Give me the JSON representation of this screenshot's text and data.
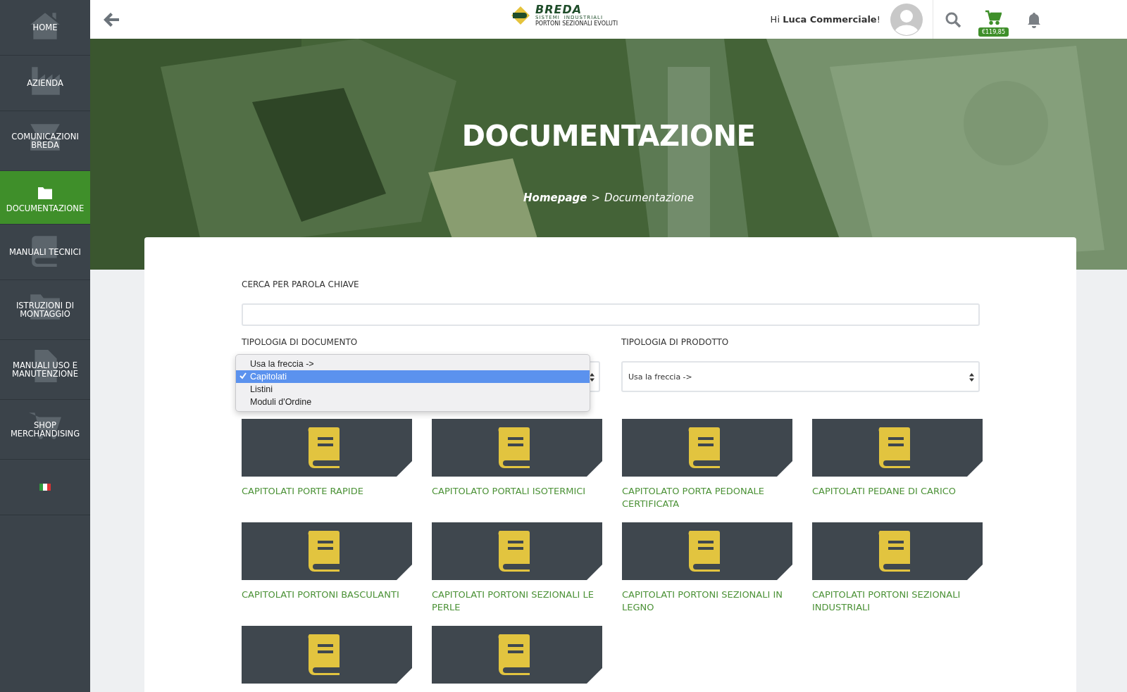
{
  "sidebar": {
    "items": [
      {
        "label": "HOME",
        "selected": false
      },
      {
        "label": "AZIENDA",
        "selected": false
      },
      {
        "label": "COMUNICAZIONI BREDA",
        "selected": false
      },
      {
        "label": "DOCUMENTAZIONE",
        "selected": true
      },
      {
        "label": "MANUALI TECNICI",
        "selected": false
      },
      {
        "label": "ISTRUZIONI DI MONTAGGIO",
        "selected": false
      },
      {
        "label": "MANUALI USO E MANUTENZIONE",
        "selected": false
      },
      {
        "label": "SHOP MERCHANDISING",
        "selected": false
      },
      {
        "selected": false
      }
    ]
  },
  "header": {
    "logo": {
      "name": "BREDA",
      "left": "SISTEMI",
      "right": "INDUSTRIALI",
      "tagline": "PORTONI SEZIONALI EVOLUTI"
    },
    "greeting": "Hi",
    "user": "Luca Commerciale",
    "punct": "!",
    "cart_total": "€119,85"
  },
  "hero": {
    "kind": "picture",
    "title": "DOCUMENTAZIONE",
    "breadcrumb": [
      {
        "label": "Homepage"
      },
      {
        "label": "Documentazione"
      }
    ],
    "separator": ">"
  },
  "search": {
    "label": "CERCA PER PAROLA CHIAVE"
  },
  "filters": [
    {
      "label": "TIPOLOGIA DI DOCUMENTO",
      "expanded": true,
      "options": [
        {
          "label": "Usa la freccia ->",
          "selected": false
        },
        {
          "label": "Capitolati",
          "selected": true
        },
        {
          "label": "Listini",
          "selected": false
        },
        {
          "label": "Moduli d'Ordine",
          "selected": false
        }
      ]
    },
    {
      "label": "TIPOLOGIA DI PRODOTTO",
      "value": "Usa la freccia ->",
      "expanded": false
    }
  ],
  "documents": [
    {
      "kind": "document",
      "title": "CAPITOLATI PORTE RAPIDE"
    },
    {
      "kind": "document",
      "title": "CAPITOLATO PORTALI ISOTERMICI"
    },
    {
      "kind": "document",
      "title": "CAPITOLATO PORTA PEDONALE CERTIFICATA"
    },
    {
      "kind": "document",
      "title": "CAPITOLATI PEDANE DI CARICO"
    },
    {
      "kind": "document",
      "title": "CAPITOLATI PORTONI BASCULANTI"
    },
    {
      "kind": "document",
      "title": "CAPITOLATI PORTONI SEZIONALI LE PERLE"
    },
    {
      "kind": "document",
      "title": "CAPITOLATI PORTONI SEZIONALI IN LEGNO"
    },
    {
      "kind": "document",
      "title": "CAPITOLATI PORTONI SEZIONALI INDUSTRIALI"
    },
    {
      "kind": "document"
    },
    {
      "kind": "document"
    }
  ]
}
